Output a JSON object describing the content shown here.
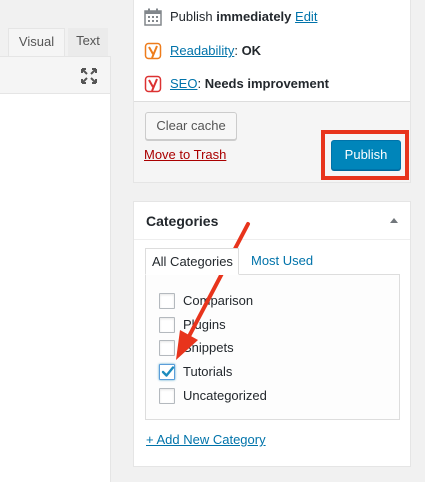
{
  "editor": {
    "tab_visual": "Visual",
    "tab_text": "Text",
    "fullscreen_icon": "expand-icon"
  },
  "publish": {
    "schedule_prefix": "Publish ",
    "schedule_value": "immediately",
    "schedule_edit": "Edit",
    "readability_link": "Readability",
    "readability_sep": ": ",
    "readability_value": "OK",
    "seo_link": "SEO",
    "seo_sep": ": ",
    "seo_value": "Needs improvement",
    "clear_cache_label": "Clear cache",
    "trash_label": "Move to Trash",
    "publish_label": "Publish",
    "calendar_icon": "calendar-icon",
    "yoast_icon_color_ok": "#ee7c1b",
    "yoast_icon_color_bad": "#dc3232"
  },
  "categories": {
    "title": "Categories",
    "tab_all": "All Categories",
    "tab_used": "Most Used",
    "items": [
      {
        "label": "Comparison",
        "checked": false
      },
      {
        "label": "Plugins",
        "checked": false
      },
      {
        "label": "Snippets",
        "checked": false
      },
      {
        "label": "Tutorials",
        "checked": true
      },
      {
        "label": "Uncategorized",
        "checked": false
      }
    ],
    "add_new": "+ Add New Category"
  },
  "colors": {
    "accent": "#0085ba",
    "annotation": "#e8341c",
    "link": "#0073aa",
    "danger": "#a00"
  }
}
